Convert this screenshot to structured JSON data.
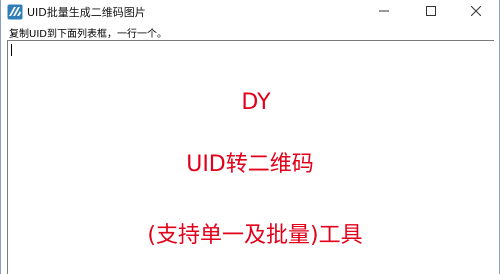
{
  "window": {
    "title": "UID批量生成二维码图片",
    "icon": "app-logo-icon",
    "controls": {
      "minimize": "—",
      "maximize": "☐",
      "close": "✕"
    }
  },
  "hint": "复制UID到下面列表框，一行一个。",
  "content": {
    "line1": "DY",
    "line2": "UID转二维码",
    "line3": "(支持单一及批量)工具"
  },
  "colors": {
    "accent_text": "#e2001a",
    "border": "#7a7a7a"
  }
}
